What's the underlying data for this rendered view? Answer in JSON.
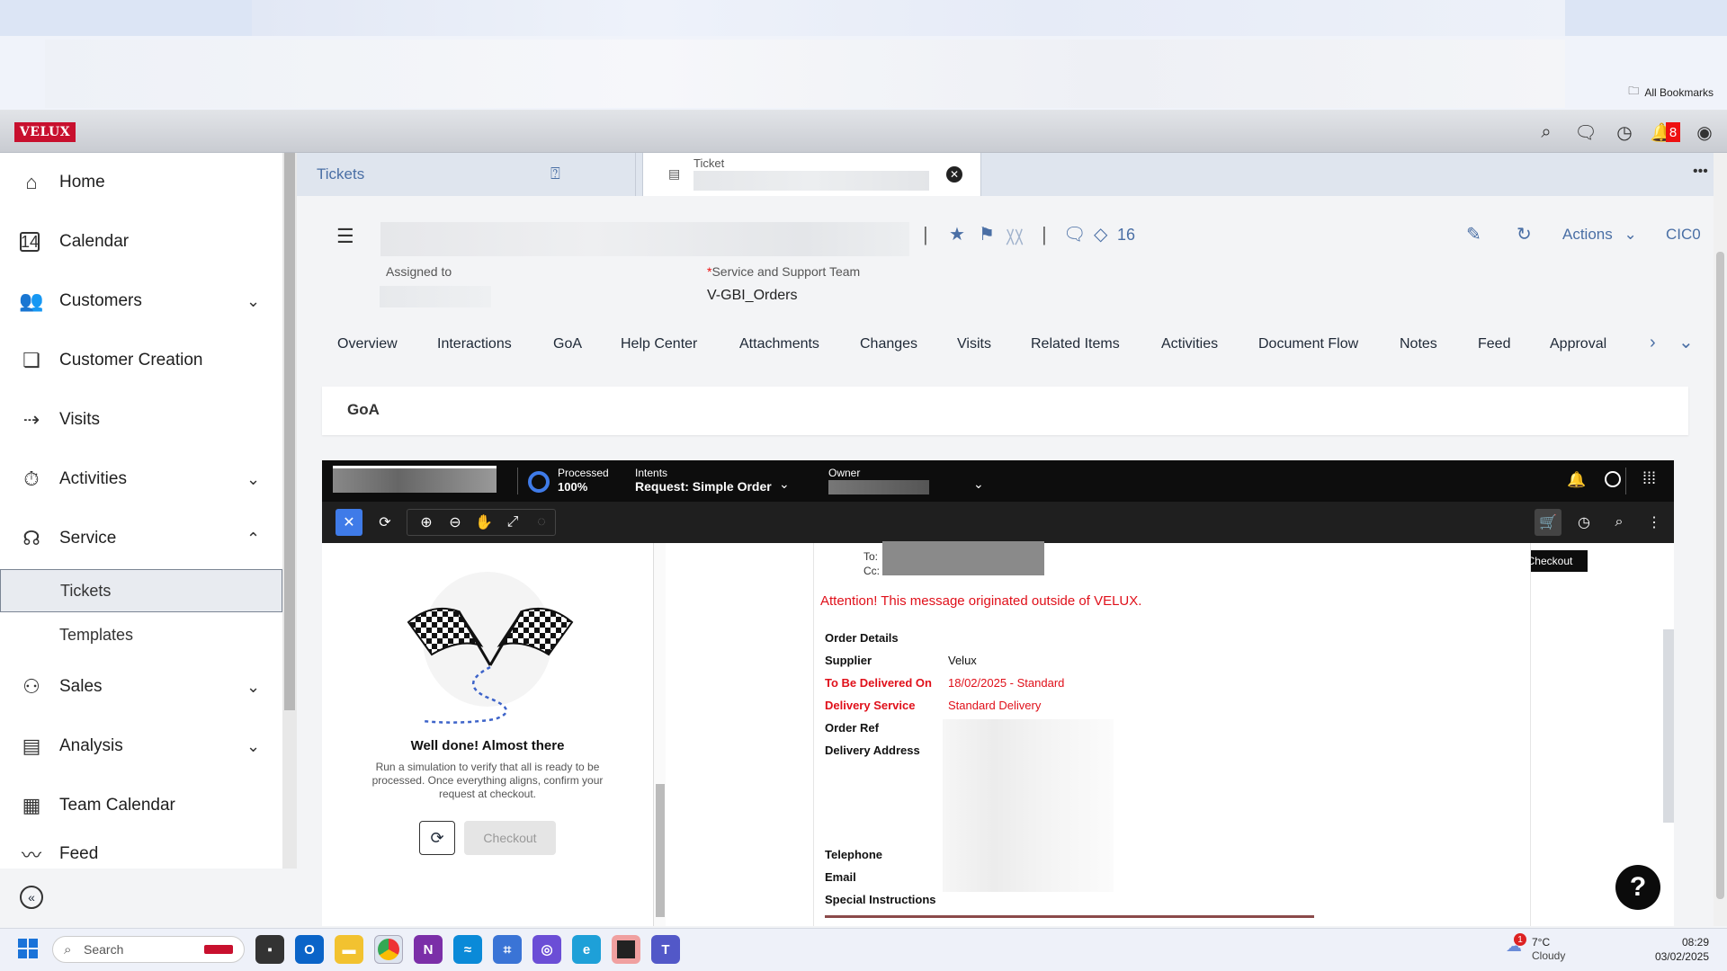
{
  "browser": {
    "all_bookmarks": "All Bookmarks"
  },
  "header": {
    "logo": "VELUX",
    "notif_count": "8"
  },
  "sidebar": {
    "items": [
      {
        "label": "Home",
        "icon": "home-icon"
      },
      {
        "label": "Calendar",
        "icon": "calendar-icon"
      },
      {
        "label": "Customers",
        "icon": "customers-icon"
      },
      {
        "label": "Customer Creation",
        "icon": "customer-creation-icon"
      },
      {
        "label": "Visits",
        "icon": "visits-icon"
      },
      {
        "label": "Activities",
        "icon": "activities-icon"
      },
      {
        "label": "Service",
        "icon": "service-icon"
      },
      {
        "label": "Sales",
        "icon": "sales-icon"
      },
      {
        "label": "Analysis",
        "icon": "analysis-icon"
      },
      {
        "label": "Team Calendar",
        "icon": "team-calendar-icon"
      },
      {
        "label": "Feed",
        "icon": "feed-icon"
      }
    ],
    "sub_items": [
      {
        "label": "Tickets"
      },
      {
        "label": "Templates"
      }
    ]
  },
  "tabs": {
    "tickets": "Tickets",
    "ticket_small": "Ticket"
  },
  "ticket": {
    "tag_count": "16",
    "actions": "Actions",
    "id_prefix": "CIC0",
    "assigned_to_label": "Assigned to",
    "team_label": "Service and Support Team",
    "team_value": "V-GBI_Orders",
    "required_star": "*"
  },
  "subnav": [
    "Overview",
    "Interactions",
    "GoA",
    "Help Center",
    "Attachments",
    "Changes",
    "Visits",
    "Related Items",
    "Activities",
    "Document Flow",
    "Notes",
    "Feed",
    "Approval"
  ],
  "goa": {
    "title": "GoA"
  },
  "embedded": {
    "processed_label": "Processed",
    "processed_value": "100%",
    "intents_label": "Intents",
    "intents_value": "Request: Simple Order",
    "owner_label": "Owner",
    "checkout_tooltip": "Checkout",
    "well_done_title": "Well done! Almost there",
    "well_done_text": "Run a simulation to verify that all is ready to be processed. Once everything aligns, confirm your request at checkout.",
    "checkout_button": "Checkout",
    "to_label": "To:",
    "cc_label": "Cc:",
    "attention": "Attention! This message originated outside of VELUX.",
    "order_details": "Order Details",
    "rows": [
      {
        "label": "Supplier",
        "value": "Velux",
        "red": false
      },
      {
        "label": "To Be Delivered On",
        "value": "18/02/2025 - Standard",
        "red": true
      },
      {
        "label": "Delivery Service",
        "value": "Standard Delivery",
        "red": true
      },
      {
        "label": "Order Ref",
        "value": "",
        "red": false
      },
      {
        "label": "Delivery Address",
        "value": "",
        "red": false
      }
    ],
    "telephone": "Telephone",
    "email": "Email",
    "special_instructions": "Special Instructions"
  },
  "taskbar": {
    "search": "Search",
    "weather_temp": "7°C",
    "weather_desc": "Cloudy",
    "weather_badge": "1",
    "time": "08:29",
    "date": "03/02/2025"
  }
}
